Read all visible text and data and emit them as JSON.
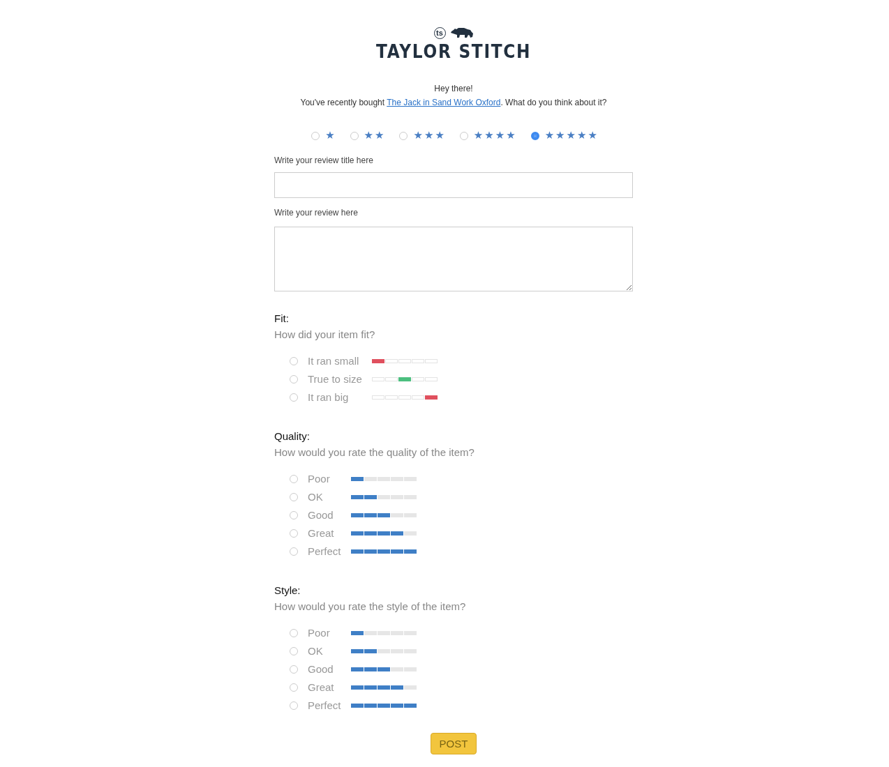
{
  "brand": {
    "monogram": "ts",
    "name": "TAYLOR STITCH"
  },
  "greeting": "Hey there!",
  "intro": {
    "before": "You've recently bought ",
    "link": "The Jack in Sand Work Oxford",
    "after": ". What do you think about it?"
  },
  "ratings": [
    {
      "label": "★",
      "selected": false
    },
    {
      "label": "★★",
      "selected": false
    },
    {
      "label": "★★★",
      "selected": false
    },
    {
      "label": "★★★★",
      "selected": false
    },
    {
      "label": "★★★★★",
      "selected": true
    }
  ],
  "title_field": {
    "label": "Write your review title here"
  },
  "review_field": {
    "label": "Write your review here"
  },
  "sections": [
    {
      "title": "Fit:",
      "question": "How did your item fit?",
      "options": [
        {
          "label": "It ran small",
          "selected": false,
          "kind": "low",
          "color": "#e0505e"
        },
        {
          "label": "True to size",
          "selected": false,
          "kind": "middle",
          "color": "#4cbf7f"
        },
        {
          "label": "It ran big",
          "selected": false,
          "kind": "high",
          "color": "#e0505e"
        }
      ]
    },
    {
      "title": "Quality:",
      "question": "How would you rate the quality of the item?",
      "options": [
        {
          "label": "Poor",
          "selected": false,
          "kind": "fill",
          "level": 0.2
        },
        {
          "label": "OK",
          "selected": false,
          "kind": "fill",
          "level": 0.4
        },
        {
          "label": "Good",
          "selected": false,
          "kind": "fill",
          "level": 0.6
        },
        {
          "label": "Great",
          "selected": false,
          "kind": "fill",
          "level": 0.8
        },
        {
          "label": "Perfect",
          "selected": false,
          "kind": "fill",
          "level": 1.0
        }
      ]
    },
    {
      "title": "Style:",
      "question": "How would you rate the style of the item?",
      "options": [
        {
          "label": "Poor",
          "selected": false,
          "kind": "fill",
          "level": 0.2
        },
        {
          "label": "OK",
          "selected": false,
          "kind": "fill",
          "level": 0.4
        },
        {
          "label": "Good",
          "selected": false,
          "kind": "fill",
          "level": 0.6
        },
        {
          "label": "Great",
          "selected": false,
          "kind": "fill",
          "level": 0.8
        },
        {
          "label": "Perfect",
          "selected": false,
          "kind": "fill",
          "level": 1.0
        }
      ]
    }
  ],
  "submit": "POST"
}
